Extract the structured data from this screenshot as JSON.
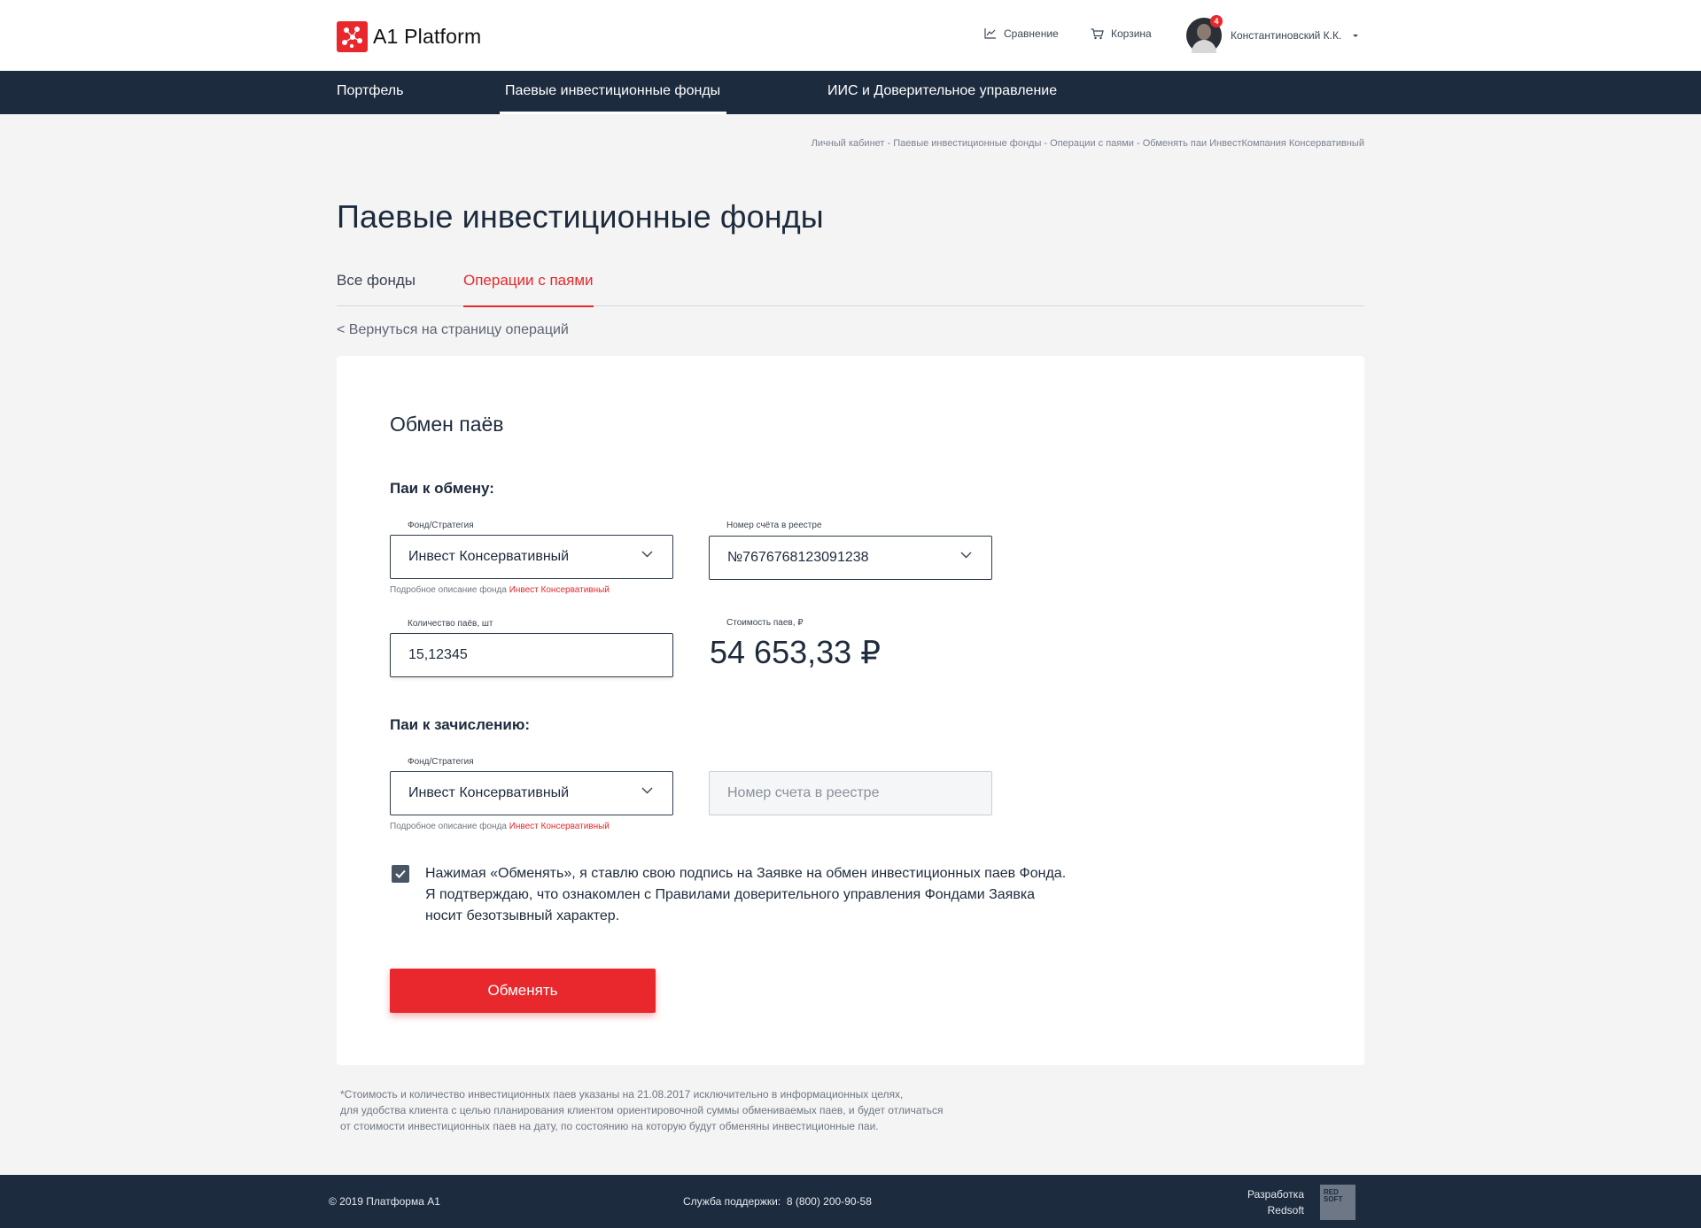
{
  "header": {
    "brand": "A1 Platform",
    "compare_label": "Сравнение",
    "cart_label": "Корзина",
    "notifications_count": "4",
    "user_name": "Константиновский К.К."
  },
  "nav": {
    "items": [
      {
        "label": "Портфель"
      },
      {
        "label": "Паевые инвестиционные фонды"
      },
      {
        "label": "ИИС и Доверительное управление"
      }
    ],
    "active_index": 1
  },
  "breadcrumb": "Личный кабинет - Паевые инвестиционные фонды - Операции с паями - Обменять паи ИнвестКомпания Консервативный",
  "page_title": "Паевые инвестиционные фонды",
  "tabs": {
    "items": [
      {
        "label": "Все фонды"
      },
      {
        "label": "Операции с паями"
      }
    ],
    "active_index": 1
  },
  "back_link": "< Вернуться на страницу операций",
  "form": {
    "title": "Обмен паёв",
    "exchange_section": "Паи к обмену:",
    "fund_label": "Фонд/Стратегия",
    "fund_value": "Инвест Консервативный",
    "account_label": "Номер счёта в реестре",
    "account_value": "№7676768123091238",
    "hint_prefix": "Подробное описание фонда ",
    "hint_link": "Инвест Консервативный",
    "quantity_label": "Количество паёв, шт",
    "quantity_value": "15,12345",
    "cost_label": "Стоимость паев, ₽",
    "cost_value": "54 653,33 ₽",
    "credit_section": "Паи к зачислению:",
    "credit_fund_label": "Фонд/Стратегия",
    "credit_fund_value": "Инвест Консервативный",
    "credit_account_placeholder": "Номер счета в реестре",
    "credit_hint_prefix": "Подробное описание фонда ",
    "credit_hint_link": "Инвест Консервативный",
    "agree_checked": true,
    "agree_line1": "Нажимая «Обменять», я ставлю свою подпись на Заявке на обмен инвестиционных  паев Фонда.",
    "agree_line2": "Я подтверждаю, что ознакомлен с Правилами доверительного управления Фондами Заявка",
    "agree_line3": "носит безотзывный характер.",
    "submit_label": "Обменять"
  },
  "footnote": {
    "line1": "*Стоимость и количество инвестиционных паев указаны на 21.08.2017 исключительно в информационных целях,",
    "line2": "для удобства клиента с целью планирования клиентом ориентировочной суммы обмениваемых паев, и будет отличаться",
    "line3": "от стоимости инвестиционных паев на дату, по состоянию на которую будут обменяны инвестиционные паи."
  },
  "footer": {
    "copyright": "© 2019  Платформа А1",
    "support_label": "Служба поддержки:",
    "support_phone": "8 (800) 200-90-58",
    "dev_line1": "Разработка",
    "dev_line2": "Redsoft",
    "redsoft_logo_line1": "RED",
    "redsoft_logo_line2": "SOFT"
  },
  "colors": {
    "accent": "#e8282c",
    "navy": "#1d2b3e",
    "background": "#f4f4f4"
  },
  "icons": {
    "compare": "chart-line-icon",
    "cart": "cart-icon",
    "select": "chevron-down-icon",
    "check": "checkmark-icon"
  }
}
